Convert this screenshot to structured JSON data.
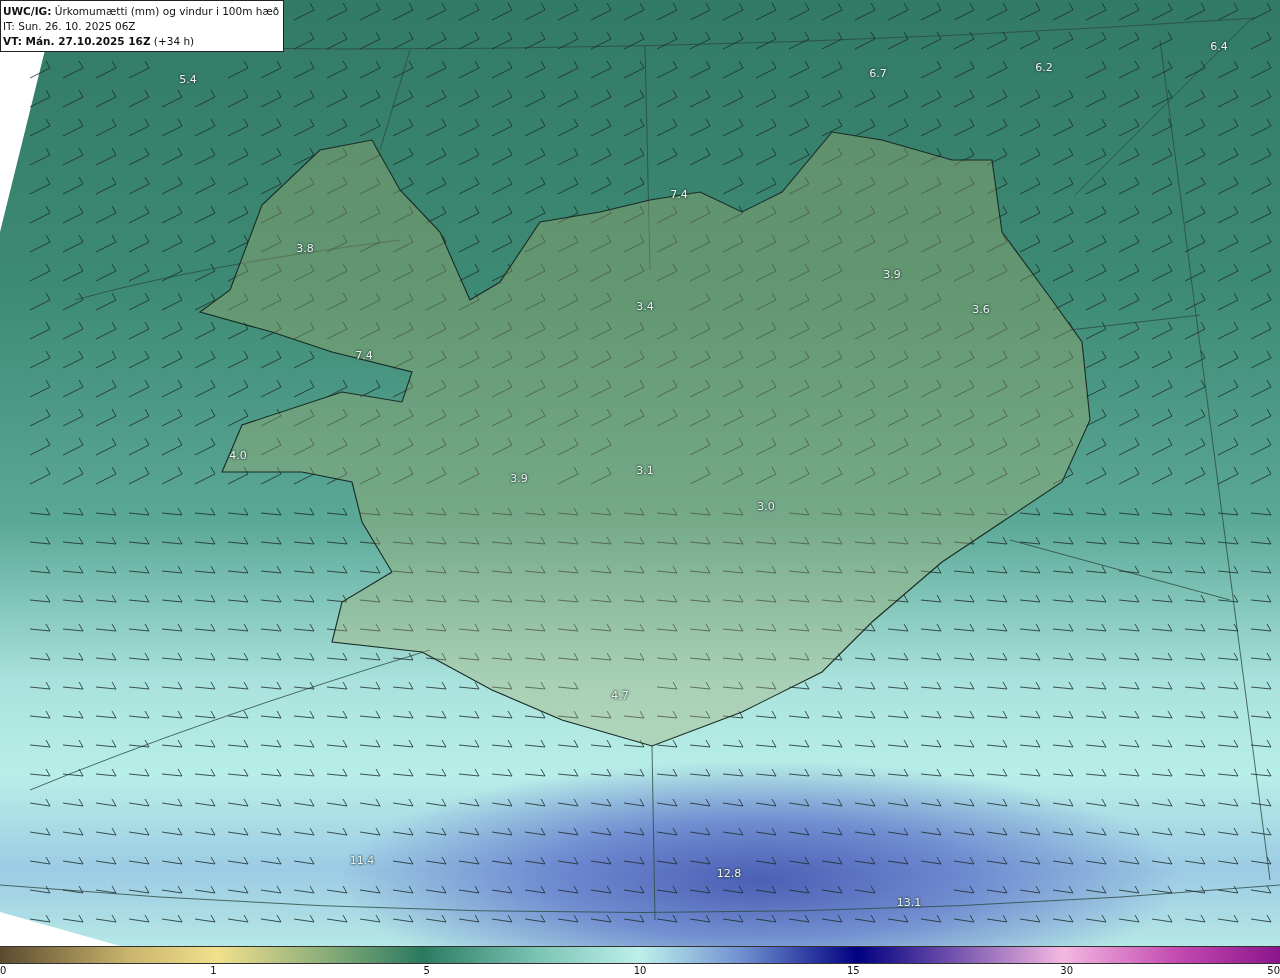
{
  "info_box": {
    "title": "**UWC/IG:** Úrkomumætti (mm) og vindur i 100m hæð",
    "issue_time": "IT: Sun. 26. 10. 2025 06Z",
    "valid_time": "**VT: Mán. 27.10.2025 16Z** (+34 h)"
  },
  "map": {
    "value_labels": [
      "5.4",
      "6.7",
      "6.2",
      "6.4",
      "7.4",
      "3.8",
      "3.4",
      "3.9",
      "3.6",
      "7.4",
      "4.0",
      "3.9",
      "3.1",
      "3.0",
      "4.7",
      "11.4",
      "12.8",
      "13.1"
    ]
  },
  "color_scale": {
    "ticks": [
      "0",
      "1",
      "5",
      "10",
      "15",
      "30",
      "50"
    ]
  }
}
